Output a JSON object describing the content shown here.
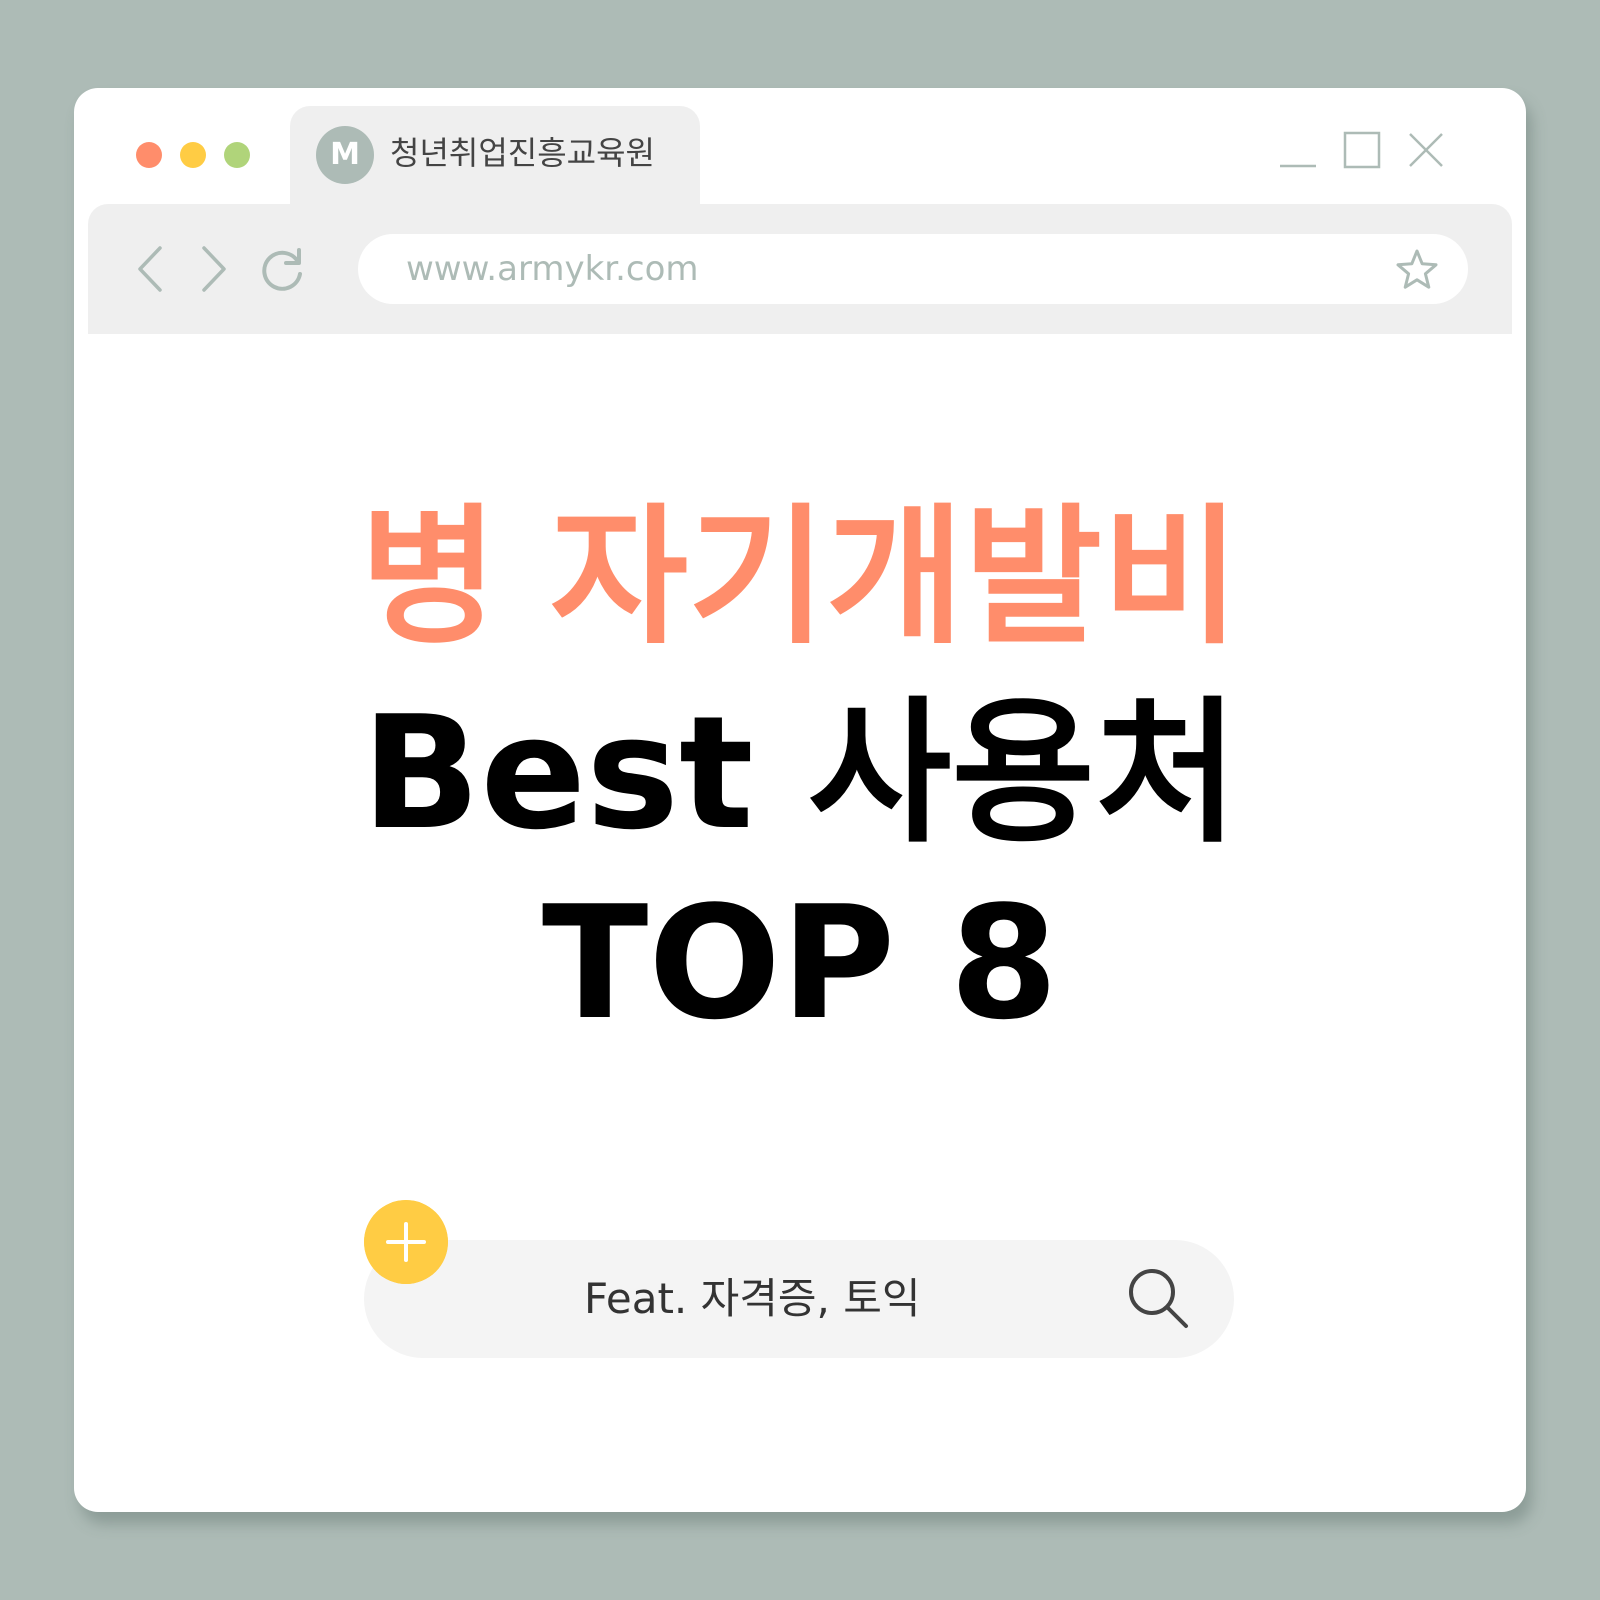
{
  "window": {
    "traffic_lights": [
      "#ff8d6b",
      "#ffcc44",
      "#b0d47a"
    ],
    "tab": {
      "favicon_letter": "M",
      "title": "청년취업진흥교육원"
    },
    "controls": [
      "minimize-icon",
      "maximize-icon",
      "close-icon"
    ]
  },
  "toolbar": {
    "buttons": [
      "chevron-left-icon",
      "chevron-right-icon",
      "refresh-icon"
    ],
    "address": "www.armykr.com",
    "bookmark_icon": "star-icon"
  },
  "main": {
    "headline_line1": "병 자기개발비",
    "headline_line2": "Best 사용처",
    "headline_line3": "TOP 8",
    "search_text": "Feat. 자격증, 토익",
    "add_icon": "plus-icon",
    "search_icon": "search-icon"
  },
  "colors": {
    "background": "#adbbb6",
    "accent": "#ff8d6b",
    "add_button": "#ffcc44",
    "chrome": "#efefef"
  }
}
